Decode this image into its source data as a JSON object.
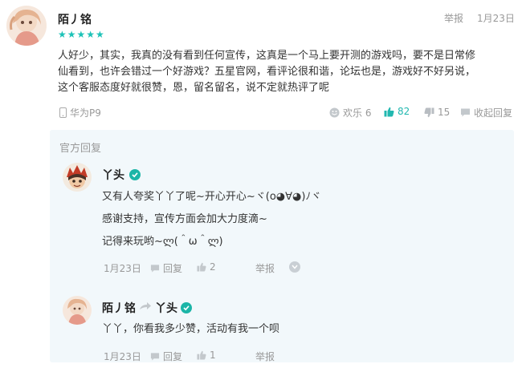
{
  "main_comment": {
    "username": "陌丿铭",
    "report_label": "举报",
    "date": "1月23日",
    "rating": "★★★★★",
    "text_lines": [
      "人好少，其实，我真的没有看到任何宣传，这真是一个马上要开测的游戏吗，要不是日常修",
      "仙看到，也许会错过一个好游戏？五星官网，看评论很和谐，论坛也是，游戏好不好另说，",
      "这个客服态度好就很赞，恩，留名留名，说不定就热评了呢"
    ],
    "device": "华为P9",
    "happy_label": "欢乐 6",
    "like_count": "82",
    "dislike_count": "15",
    "collapse_reply_label": "收起回复"
  },
  "official_reply": {
    "section_title": "官方回复",
    "username": "丫头",
    "lines": [
      "又有人夸奖丫丫了呢~开心开心~ヾ(o◕∀◕)ﾉヾ",
      "感谢支持，宣传方面会加大力度滴~",
      "记得来玩哟~ლ(＾ω＾ლ)"
    ],
    "date": "1月23日",
    "reply_label": "回复",
    "like_count": "2",
    "report_label": "举报"
  },
  "sub_reply": {
    "from_user": "陌丿铭",
    "to_user": "丫头",
    "text": "丫丫，你看我多少赞，活动有我一个呗",
    "date": "1月23日",
    "reply_label": "回复",
    "like_count": "1",
    "report_label": "举报"
  },
  "colors": {
    "accent_teal": "#22b8b0",
    "reply_bg": "#f2f8fb",
    "verified_badge": "#1cb5a7"
  },
  "icons": {
    "device": "phone-icon",
    "happy": "smile-icon",
    "like": "thumbs-up-icon",
    "dislike": "thumbs-down-icon",
    "collapse": "chat-bubble-icon",
    "verified": "verified-check-icon",
    "reply_arrow": "reply-arrow-icon",
    "more": "chevron-down-icon"
  }
}
